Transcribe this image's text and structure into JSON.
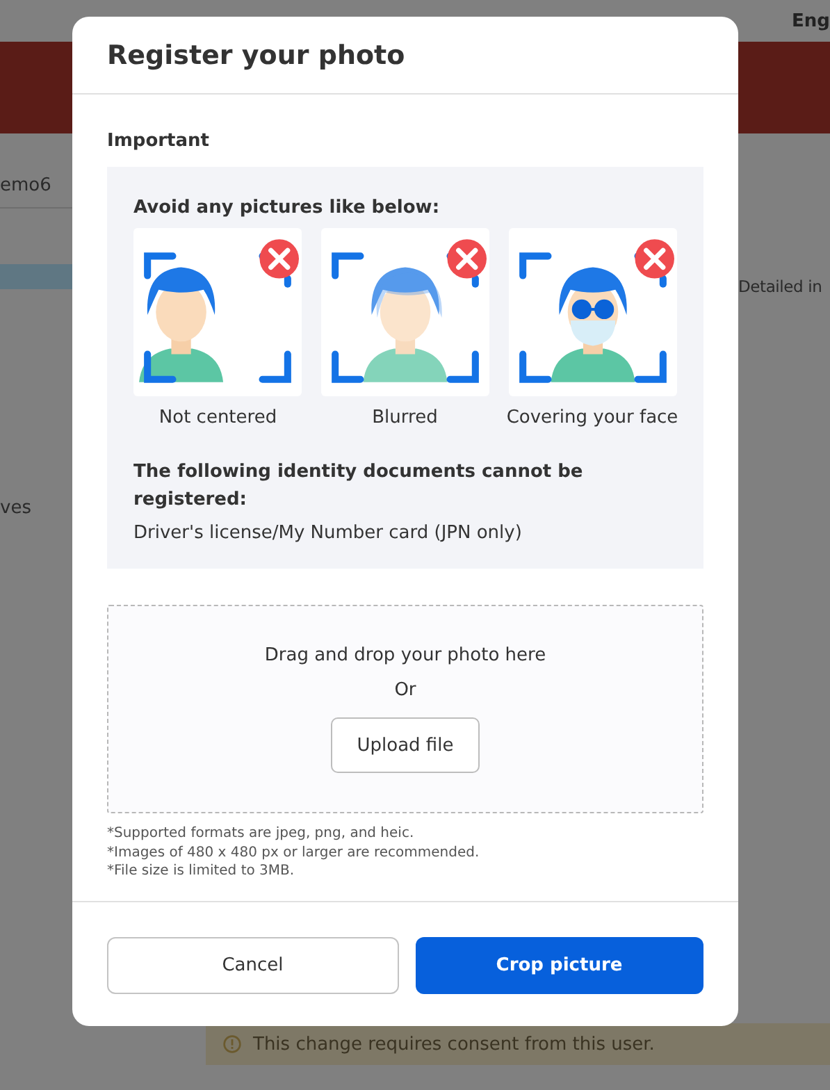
{
  "background": {
    "language": "Eng",
    "user_fragment": "emo6",
    "menu_fragment": "ves",
    "detail_fragment": "Detailed in",
    "notice": "This change requires consent from this user."
  },
  "dialog": {
    "title": "Register your photo",
    "section_title": "Important",
    "avoid_title": "Avoid any pictures like below:",
    "examples": [
      {
        "kind": "off_center",
        "caption": "Not centered"
      },
      {
        "kind": "blurred",
        "caption": "Blurred"
      },
      {
        "kind": "covered",
        "caption": "Covering your face"
      }
    ],
    "documents_title": "The following identity documents cannot be registered:",
    "documents_text": "Driver's license/My Number card (JPN only)",
    "dropzone": {
      "text": "Drag and drop your photo here",
      "or": "Or",
      "button": "Upload file"
    },
    "notes": [
      "*Supported formats are jpeg, png, and heic.",
      "*Images of 480 x 480 px or larger are recommended.",
      "*File size is limited to 3MB."
    ],
    "buttons": [
      {
        "kind": "secondary",
        "label": "Cancel"
      },
      {
        "kind": "primary",
        "label": "Crop picture"
      }
    ]
  }
}
